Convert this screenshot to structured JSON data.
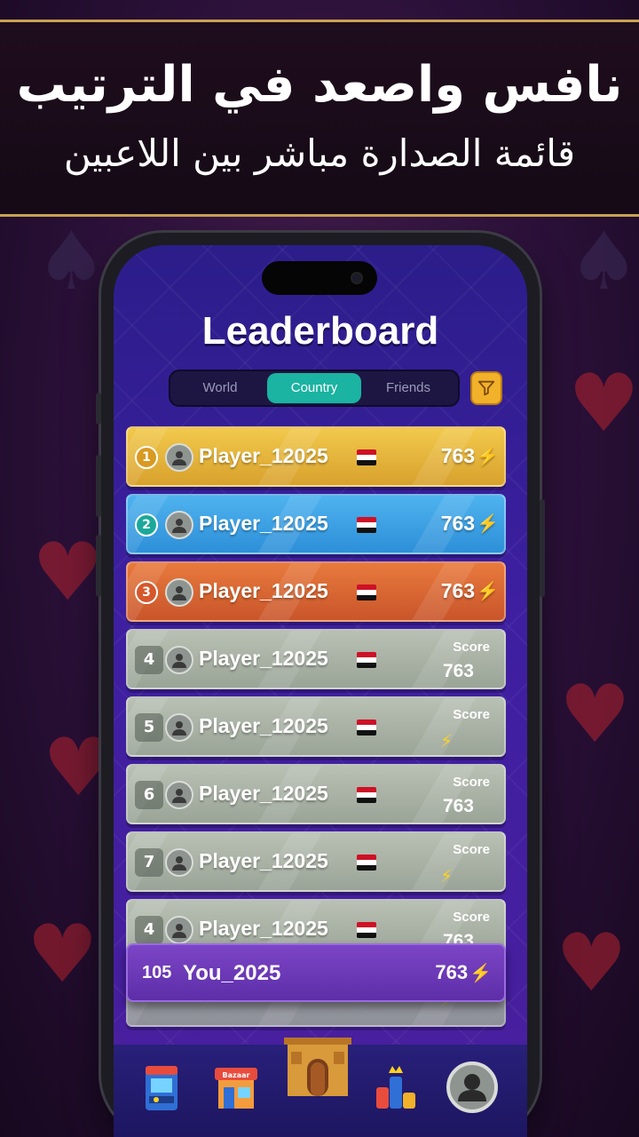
{
  "banner": {
    "title": "نافس واصعد في الترتيب",
    "subtitle": "قائمة الصدارة مباشر بين اللاعبين"
  },
  "screen": {
    "title": "Leaderboard",
    "tabs": [
      {
        "label": "World",
        "active": false
      },
      {
        "label": "Country",
        "active": true
      },
      {
        "label": "Friends",
        "active": false
      }
    ],
    "filter_icon": "filter-icon"
  },
  "rows": [
    {
      "rank": "1",
      "name": "Player_12025",
      "score": "763",
      "style": "gold"
    },
    {
      "rank": "2",
      "name": "Player_12025",
      "score": "763",
      "style": "blue"
    },
    {
      "rank": "3",
      "name": "Player_12025",
      "score": "763",
      "style": "bronze"
    },
    {
      "rank": "4",
      "name": "Player_12025",
      "score_label": "Score",
      "score": "763",
      "style": "grey"
    },
    {
      "rank": "5",
      "name": "Player_12025",
      "score_label": "Score",
      "score": "",
      "style": "grey"
    },
    {
      "rank": "6",
      "name": "Player_12025",
      "score_label": "Score",
      "score": "763",
      "style": "grey"
    },
    {
      "rank": "7",
      "name": "Player_12025",
      "score_label": "Score",
      "score": "",
      "style": "grey"
    },
    {
      "rank": "4",
      "name": "Player_12025",
      "score_label": "Score",
      "score": "763",
      "style": "grey"
    }
  ],
  "me": {
    "rank": "105",
    "name": "You_2025",
    "score": "763"
  },
  "nav": [
    "arcade-icon",
    "bazaar-icon",
    "home-palace-icon",
    "leaderboard-icon",
    "profile-icon"
  ],
  "nav_labels": {
    "bazaar": "Bazaar"
  },
  "colors": {
    "accent_teal": "#1bb3a1",
    "gold": "#f2c94c",
    "filter": "#f1b12a",
    "bolt": "#ffd21e"
  }
}
